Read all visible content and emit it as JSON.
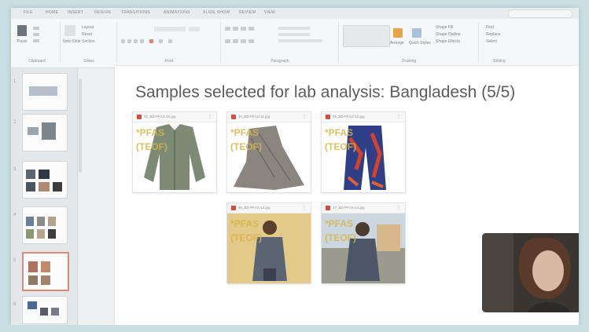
{
  "ribbon": {
    "tabs": [
      "FILE",
      "HOME",
      "INSERT",
      "DESIGN",
      "TRANSITIONS",
      "ANIMATIONS",
      "SLIDE SHOW",
      "REVIEW",
      "VIEW"
    ],
    "groups": [
      "Clipboard",
      "Slides",
      "Font",
      "Paragraph",
      "Drawing",
      "Editing"
    ],
    "buttons": {
      "paste": "Paste",
      "new_slide": "New Slide",
      "layout": "Layout",
      "reset": "Reset",
      "section": "Section",
      "arrange": "Arrange",
      "quick_styles": "Quick Styles",
      "shape_fill": "Shape Fill",
      "shape_outline": "Shape Outline",
      "shape_effects": "Shape Effects",
      "find": "Find",
      "replace": "Replace",
      "select": "Select"
    }
  },
  "thumbnails": [
    "1",
    "2",
    "3",
    "4",
    "5",
    "6"
  ],
  "slide": {
    "title": "Samples selected for lab analysis: Bangladesh (5/5)",
    "cards": [
      {
        "file": "43_BD-PFAS-10.jpg",
        "wm1": "*PFAS",
        "wm2": "(TEOF)"
      },
      {
        "file": "44_BD-PFAS-11.jpg",
        "wm1": "*PFAS",
        "wm2": "(TEOF)"
      },
      {
        "file": "45_BD-PFAS-12.jpg",
        "wm1": "*PFAS",
        "wm2": "(TEOF)"
      },
      {
        "file": "46_BD-PFAS-13.jpg",
        "wm1": "*PFAS",
        "wm2": "(TEOF)"
      },
      {
        "file": "47_BD-PFAS-14.jpg",
        "wm1": "*PFAS",
        "wm2": "(TEOF)"
      }
    ]
  },
  "colors": {
    "background": "#c9dfe3",
    "slide": "#ffffff",
    "watermark": "#d7b64a",
    "pdf_icon": "#d64c45"
  }
}
